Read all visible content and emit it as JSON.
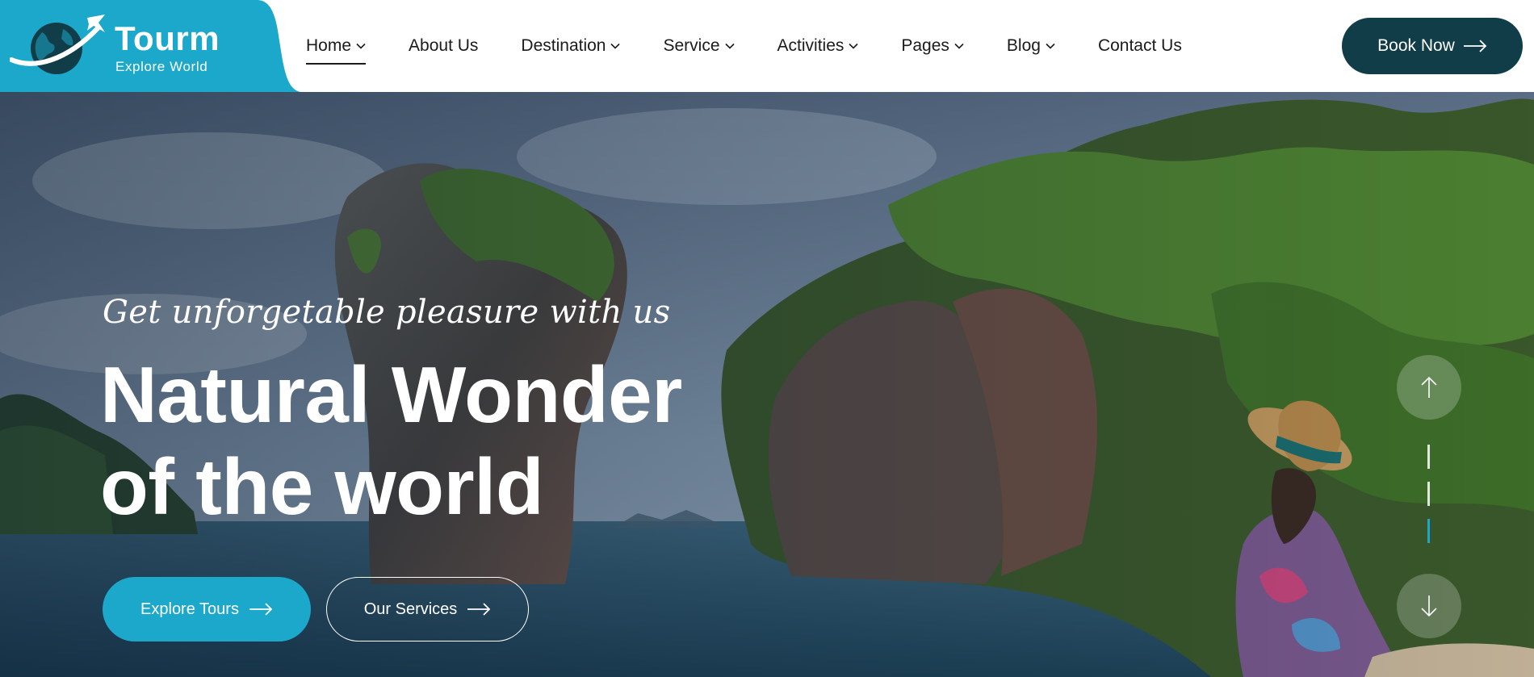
{
  "brand": {
    "name": "Tourm",
    "tagline": "Explore World",
    "primary_color": "#1ca8cb",
    "dark_color": "#113d48"
  },
  "nav": {
    "items": [
      {
        "label": "Home",
        "has_dropdown": true,
        "active": true
      },
      {
        "label": "About Us",
        "has_dropdown": false,
        "active": false
      },
      {
        "label": "Destination",
        "has_dropdown": true,
        "active": false
      },
      {
        "label": "Service",
        "has_dropdown": true,
        "active": false
      },
      {
        "label": "Activities",
        "has_dropdown": true,
        "active": false
      },
      {
        "label": "Pages",
        "has_dropdown": true,
        "active": false
      },
      {
        "label": "Blog",
        "has_dropdown": true,
        "active": false
      },
      {
        "label": "Contact Us",
        "has_dropdown": false,
        "active": false
      }
    ],
    "cta_label": "Book Now",
    "cta_icon": "arrow-right-icon"
  },
  "hero": {
    "tagline": "Get unforgetable pleasure with us",
    "headline_line1": "Natural Wonder",
    "headline_line2": "of the world",
    "primary_button": "Explore Tours",
    "secondary_button": "Our Services",
    "slider": {
      "up_icon": "arrow-up-icon",
      "down_icon": "arrow-down-icon",
      "slide_count": 3,
      "active_slide": 3
    }
  }
}
